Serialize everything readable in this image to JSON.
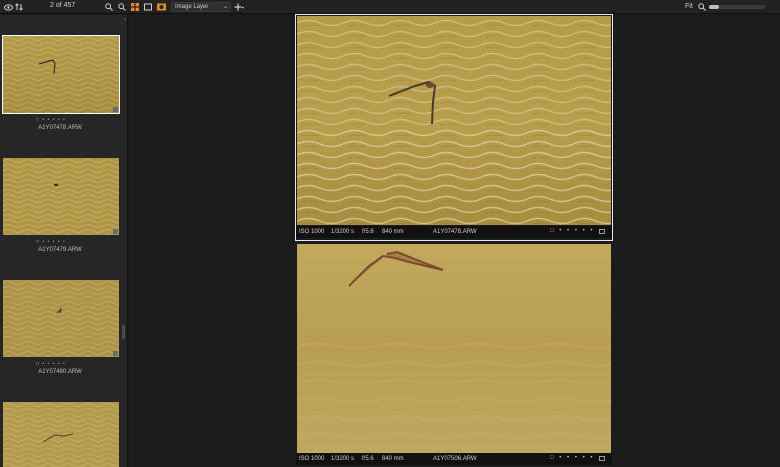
{
  "toolbar": {
    "counter": "2 of 457",
    "layer_select": "Image Layer",
    "fit_label": "Fit",
    "zoom_level": 0.18
  },
  "thumbnails": [
    {
      "name": "A1Y07478.ARW",
      "selected": true,
      "rating": "□ • • • • •"
    },
    {
      "name": "A1Y07479.ARW",
      "selected": false,
      "rating": "□ • • • • •"
    },
    {
      "name": "A1Y07480.ARW",
      "selected": false,
      "rating": "□ • • • • •"
    },
    {
      "name": "",
      "selected": false,
      "rating": ""
    }
  ],
  "viewer": {
    "panes": [
      {
        "iso": "ISO 1000",
        "shutter": "1/3200 s",
        "aperture": "f/5.6",
        "focal": "840 mm",
        "filename": "A1Y07478.ARW",
        "rating": "□ • • • • •",
        "selected": true
      },
      {
        "iso": "ISO 1000",
        "shutter": "1/3200 s",
        "aperture": "f/5.6",
        "focal": "840 mm",
        "filename": "A1Y07506.ARW",
        "rating": "□ • • • • •",
        "selected": false
      }
    ]
  }
}
